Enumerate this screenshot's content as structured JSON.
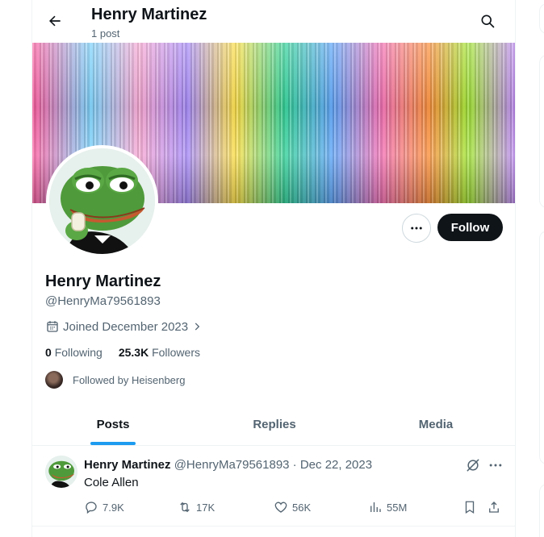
{
  "header": {
    "title": "Henry Martinez",
    "post_count": "1 post"
  },
  "profile": {
    "name": "Henry Martinez",
    "handle": "@HenryMa79561893",
    "joined": "Joined December 2023",
    "following_count": "0",
    "following_label": "Following",
    "followers_count": "25.3K",
    "followers_label": "Followers",
    "followed_by": "Followed by Heisenberg",
    "follow_label": "Follow"
  },
  "tabs": [
    {
      "label": "Posts",
      "active": true
    },
    {
      "label": "Replies",
      "active": false
    },
    {
      "label": "Media",
      "active": false
    }
  ],
  "post": {
    "author": "Henry Martinez",
    "handle_date": "@HenryMa79561893 · Dec 22, 2023",
    "text": "Cole Allen",
    "replies": "7.9K",
    "reposts": "17K",
    "likes": "56K",
    "views": "55M"
  },
  "colors": {
    "accent": "#1d9bf0",
    "text_primary": "#0f1419",
    "text_secondary": "#536471",
    "follow_button_bg": "#0f1419",
    "border": "#eff3f4"
  },
  "icons": {
    "back": "arrow-left-icon",
    "search": "search-icon",
    "more": "more-horizontal-icon",
    "calendar": "calendar-icon",
    "chevron": "chevron-right-icon",
    "grok": "grok-icon",
    "reply": "reply-icon",
    "repost": "repost-icon",
    "like": "heart-icon",
    "views": "views-icon",
    "bookmark": "bookmark-icon",
    "share": "share-icon"
  }
}
